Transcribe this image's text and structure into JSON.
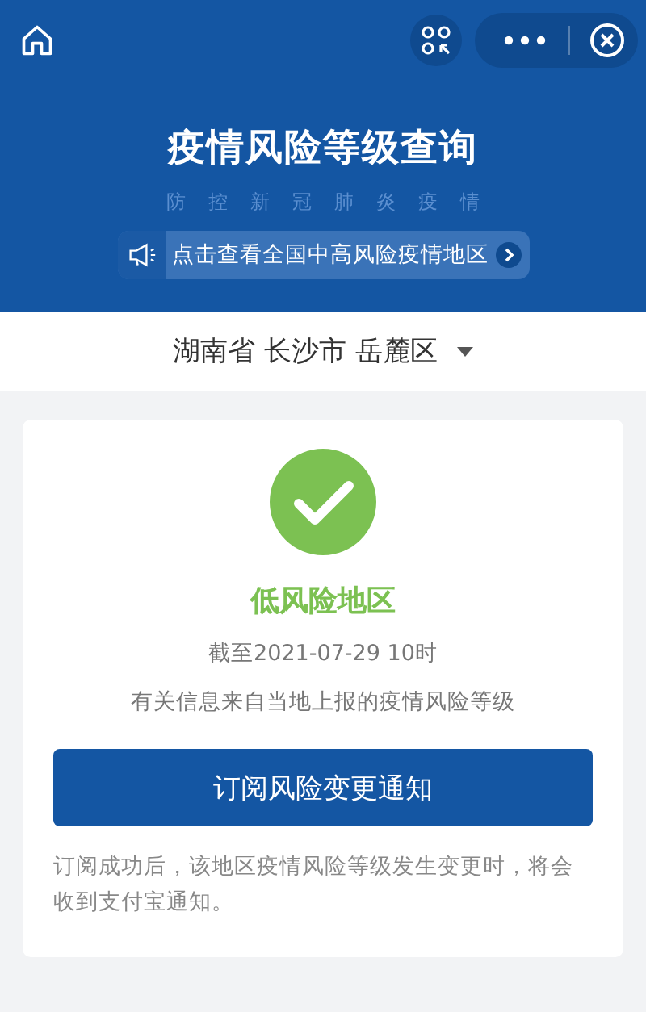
{
  "header": {
    "title": "疫情风险等级查询",
    "subtitle": "防控新冠肺炎疫情",
    "banner": "点击查看全国中高风险疫情地区"
  },
  "location": {
    "value": "湖南省 长沙市 岳麓区"
  },
  "result": {
    "kind": "low",
    "level_label": "低风险地区",
    "updated": "截至2021-07-29 10时",
    "source": "有关信息来自当地上报的疫情风险等级",
    "button": "订阅风险变更通知",
    "note": "订阅成功后，该地区疫情风险等级发生变更时，将会收到支付宝通知。"
  }
}
